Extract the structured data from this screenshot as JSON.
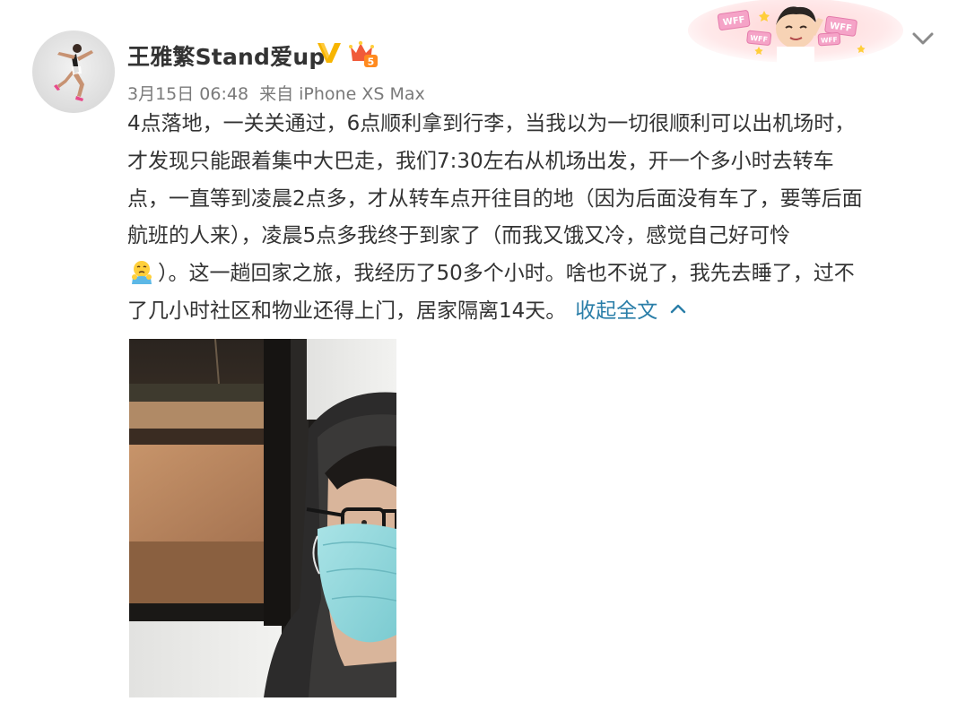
{
  "post": {
    "author_name": "王雅繁Stand爱up",
    "date": "3月15日 06:48",
    "source": "来自 iPhone XS Max",
    "crown_level": "5",
    "banner_labels": [
      "WFF",
      "WFF",
      "WFF",
      "WFF"
    ],
    "text_lines": [
      "4点落地，一关关通过，6点顺利拿到行李，当我以为一切很顺利可以出机场时，",
      "才发现只能跟着集中大巴走，我们7:30左右从机场出发，开一个多小时去转车",
      "点，一直等到凌晨2点多，才从转车点开往目的地（因为后面没有车了，要等后面",
      "航班的人来），凌晨5点多我终于到家了（而我又饿又冷，感觉自己好可怜",
      "）。这一趟回家之旅，我经历了50多个小时。啥也不说了，我先去睡了，过不",
      "了几小时社区和物业还得上门，居家隔离14天。"
    ],
    "collapse_label": "收起全文"
  },
  "colors": {
    "link": "#2a7ea8",
    "meta": "#7a7a7a",
    "text": "#333333",
    "verified": "#f7b500"
  },
  "icons": {
    "verified": "verified-v-icon",
    "crown": "crown-icon",
    "emoji": "pitiful-emoji-icon",
    "expand": "chevron-down-icon",
    "collapse": "chevron-up-icon"
  }
}
